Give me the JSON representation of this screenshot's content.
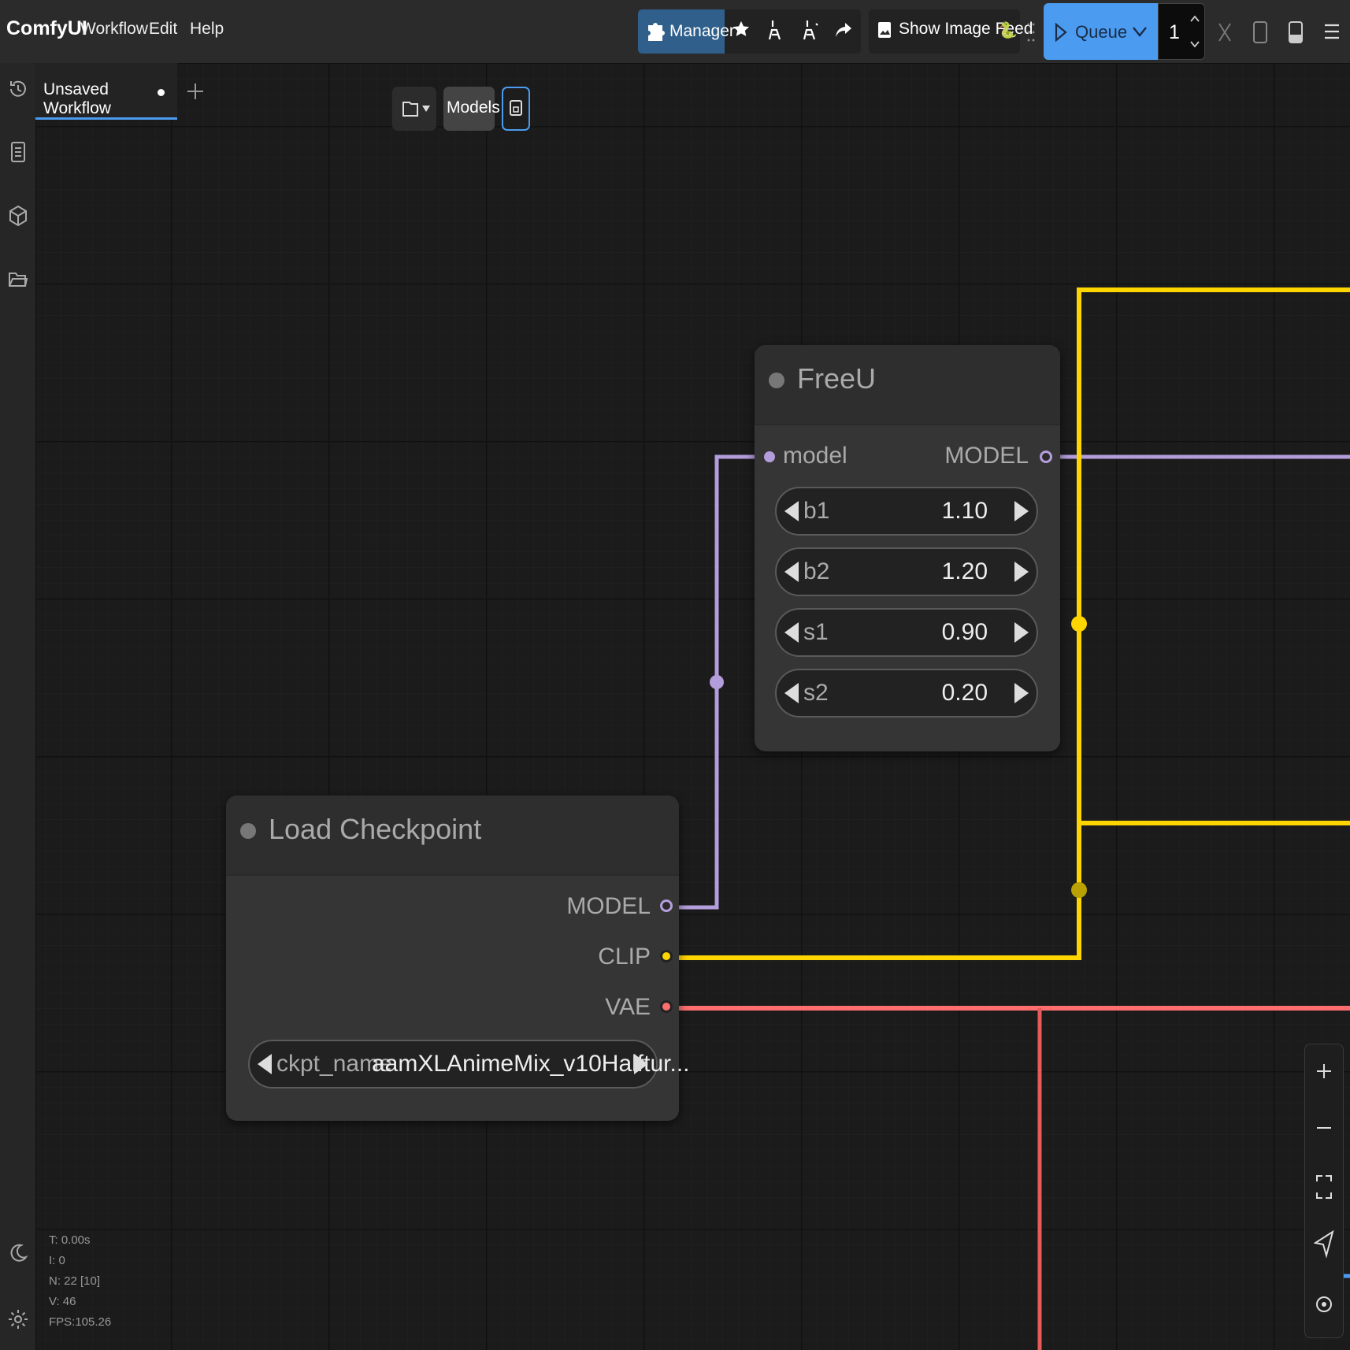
{
  "app": {
    "brand": "ComfyUI",
    "menu": [
      "Workflow",
      "Edit",
      "Help"
    ]
  },
  "toolbar": {
    "manager_label": "Manager",
    "image_feed_label": "Show Image Feed",
    "queue_label": "Queue",
    "queue_count": "1"
  },
  "tabs": [
    {
      "label": "Unsaved Workflow",
      "modified": true
    }
  ],
  "canvas_toolbar": {
    "models_label": "Models"
  },
  "nodes": {
    "freeu": {
      "title": "FreeU",
      "input": "model",
      "output": "MODEL",
      "widgets": [
        {
          "name": "b1",
          "value": "1.10"
        },
        {
          "name": "b2",
          "value": "1.20"
        },
        {
          "name": "s1",
          "value": "0.90"
        },
        {
          "name": "s2",
          "value": "0.20"
        }
      ]
    },
    "load_checkpoint": {
      "title": "Load Checkpoint",
      "outputs": [
        "MODEL",
        "CLIP",
        "VAE"
      ],
      "widget": {
        "name": "ckpt_name",
        "value": "aamXLAnimeMix_v10Halftur..."
      }
    }
  },
  "stats": {
    "t": "T: 0.00s",
    "i": "I: 0",
    "n": "N: 22 [10]",
    "v": "V: 46",
    "fps": "FPS:105.26"
  },
  "colors": {
    "model_wire": "#b39ddb",
    "clip_wire": "#ffd500",
    "vae_wire": "#ff6e6e",
    "queue_button": "#4b9cf0",
    "manager_button": "#2f5f8a"
  }
}
